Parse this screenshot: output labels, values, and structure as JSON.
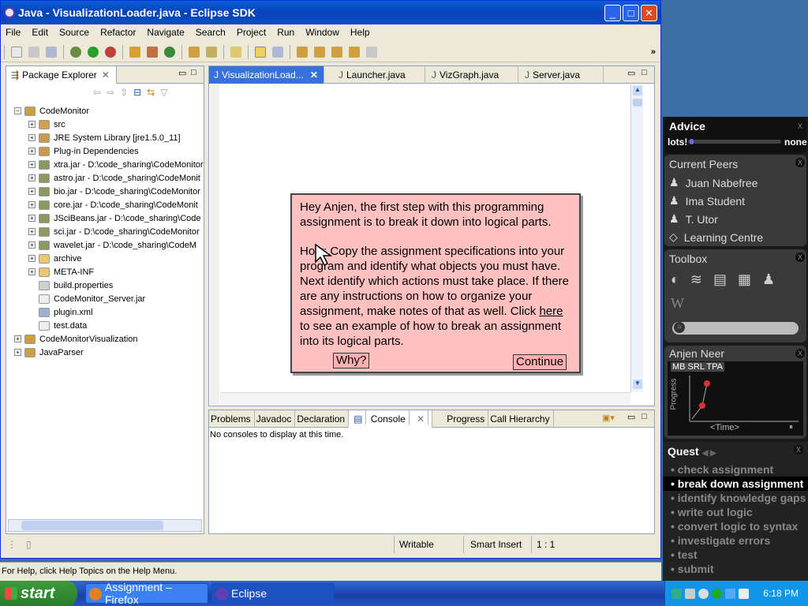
{
  "window": {
    "title": "Java - VisualizationLoader.java - Eclipse SDK"
  },
  "menu": [
    "File",
    "Edit",
    "Source",
    "Refactor",
    "Navigate",
    "Search",
    "Project",
    "Run",
    "Window",
    "Help"
  ],
  "package_explorer": {
    "tab_label": "Package Explorer",
    "items": [
      {
        "label": "CodeMonitor",
        "level": 0,
        "icon": "project-icon",
        "expanded": true
      },
      {
        "label": "src",
        "level": 1,
        "icon": "source-folder-icon"
      },
      {
        "label": "JRE System Library [jre1.5.0_11]",
        "level": 1,
        "icon": "library-icon"
      },
      {
        "label": "Plug-in Dependencies",
        "level": 1,
        "icon": "library-icon"
      },
      {
        "label": "xtra.jar - D:\\code_sharing\\CodeMonitor",
        "level": 1,
        "icon": "jar-icon"
      },
      {
        "label": "astro.jar - D:\\code_sharing\\CodeMonit",
        "level": 1,
        "icon": "jar-icon"
      },
      {
        "label": "bio.jar - D:\\code_sharing\\CodeMonitor",
        "level": 1,
        "icon": "jar-icon"
      },
      {
        "label": "core.jar - D:\\code_sharing\\CodeMonit",
        "level": 1,
        "icon": "jar-icon"
      },
      {
        "label": "JSciBeans.jar - D:\\code_sharing\\Code",
        "level": 1,
        "icon": "jar-icon"
      },
      {
        "label": "sci.jar - D:\\code_sharing\\CodeMonitor",
        "level": 1,
        "icon": "jar-icon"
      },
      {
        "label": "wavelet.jar - D:\\code_sharing\\CodeM",
        "level": 1,
        "icon": "jar-icon"
      },
      {
        "label": "archive",
        "level": 1,
        "icon": "folder-icon"
      },
      {
        "label": "META-INF",
        "level": 1,
        "icon": "folder-icon"
      },
      {
        "label": "build.properties",
        "level": 1,
        "icon": "properties-file-icon",
        "leaf": true
      },
      {
        "label": "CodeMonitor_Server.jar",
        "level": 1,
        "icon": "file-icon",
        "leaf": true
      },
      {
        "label": "plugin.xml",
        "level": 1,
        "icon": "xml-file-icon",
        "leaf": true
      },
      {
        "label": "test.data",
        "level": 1,
        "icon": "file-icon",
        "leaf": true
      },
      {
        "label": "CodeMonitorVisualization",
        "level": 0,
        "icon": "project-icon"
      },
      {
        "label": "JavaParser",
        "level": 0,
        "icon": "project-icon"
      }
    ]
  },
  "editor_tabs": [
    {
      "label": "VisualizationLoad...",
      "active": true
    },
    {
      "label": "Launcher.java"
    },
    {
      "label": "VizGraph.java"
    },
    {
      "label": "Server.java"
    }
  ],
  "dialog": {
    "para1": "Hey Anjen, the first step with this programming assignment is to break it down into logical parts.",
    "para2_a": "How: Copy the assignment specifications into your program and identify what objects you must have. Next identify which actions must take place. If there are any instructions on how to organize your assignment, make notes of that as well. Click ",
    "para2_link": "here",
    "para2_b": " to see an example of how to break an assignment into its logical parts.",
    "why_button": "Why?",
    "continue_button": "Continue"
  },
  "console": {
    "tabs": [
      "Problems",
      "Javadoc",
      "Declaration",
      "Console",
      "Progress",
      "Call Hierarchy"
    ],
    "message": "No consoles to display at this time."
  },
  "status": {
    "writable": "Writable",
    "insert_mode": "Smart Insert",
    "position": "1 : 1"
  },
  "help_text": "For Help, click Help Topics on the Help Menu.",
  "sidebar": {
    "advice": {
      "title": "Advice",
      "left_label": "lots!",
      "right_label": "none",
      "level": 0.02
    },
    "peers": {
      "title": "Current Peers",
      "items": [
        "Juan Nabefree",
        "Ima Student",
        "T. Utor",
        "Learning Centre"
      ]
    },
    "toolbox": {
      "title": "Toolbox"
    },
    "progress": {
      "title": "Anjen Neer",
      "tabs": "MB SRL TPA",
      "y_label": "Progress",
      "x_label": "Time"
    },
    "quest": {
      "title": "Quest",
      "items": [
        "check assignment",
        "break down assignment",
        "identify knowledge gaps",
        "write out logic",
        "convert logic to syntax",
        "investigate errors",
        "test",
        "submit"
      ],
      "active_index": 1
    }
  },
  "taskbar": {
    "start": "start",
    "tasks": [
      "Assignment – Firefox",
      "Eclipse"
    ],
    "clock": "6:18 PM"
  }
}
